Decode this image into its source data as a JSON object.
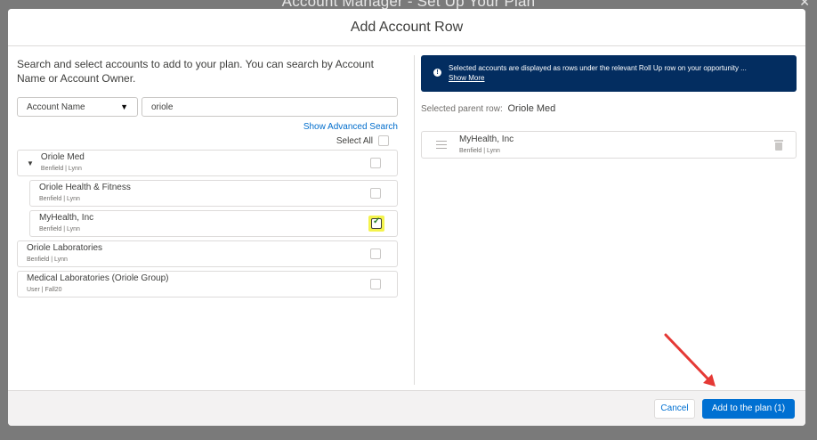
{
  "background": {
    "title": "Account Manager - Set Up Your Plan",
    "close": "✕"
  },
  "modal": {
    "title": "Add Account Row"
  },
  "left": {
    "intro": "Search and select accounts to add to your plan. You can search by Account Name or Account Owner.",
    "search_field": "Account Name",
    "search_value": "oriole",
    "advanced_link": "Show Advanced Search",
    "select_all_label": "Select All",
    "items": [
      {
        "name": "Oriole Med",
        "sub": "Benfield | Lynn"
      },
      {
        "name": "Oriole Health & Fitness",
        "sub": "Benfield | Lynn"
      },
      {
        "name": "MyHealth, Inc",
        "sub": "Benfield | Lynn"
      },
      {
        "name": "Oriole Laboratories",
        "sub": "Benfield | Lynn"
      },
      {
        "name": "Medical Laboratories (Oriole Group)",
        "sub": "User | Fall20"
      }
    ]
  },
  "right": {
    "banner_text": "Selected accounts are displayed as rows under the relevant Roll Up row on your opportunity ...",
    "banner_link": "Show More",
    "parent_label": "Selected parent row:",
    "parent_value": "Oriole Med",
    "selected": [
      {
        "name": "MyHealth, Inc",
        "sub": "Benfield | Lynn"
      }
    ]
  },
  "footer": {
    "cancel": "Cancel",
    "add": "Add to the plan (1)"
  },
  "colors": {
    "brand": "#0070d2",
    "banner": "#032d60",
    "highlight": "#f4f34d",
    "arrow": "#e53935"
  }
}
